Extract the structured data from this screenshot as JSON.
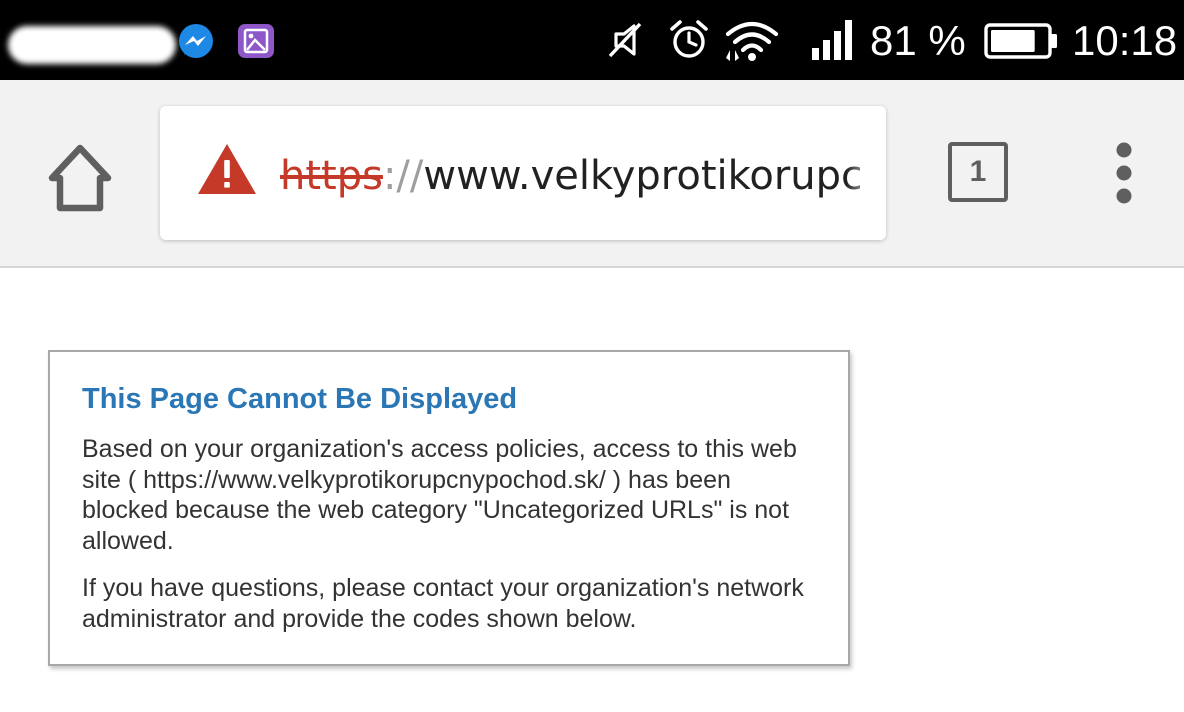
{
  "status_bar": {
    "battery_percent_text": "81 %",
    "battery_level": 0.81,
    "time": "10:18",
    "icons": [
      "messenger-icon",
      "gallery-icon",
      "mute-icon",
      "alarm-icon",
      "wifi-icon",
      "signal-icon",
      "battery-icon"
    ]
  },
  "toolbar": {
    "url_scheme": "https",
    "url_separator": "://",
    "url_host": "www.velkyprotikorupc",
    "tab_count": "1",
    "icons": [
      "home-icon",
      "warning-icon",
      "tab-switcher-icon",
      "more-vert-icon"
    ]
  },
  "page": {
    "title": "This Page Cannot Be Displayed",
    "paragraph_1": "Based on your organization's access policies, access to this web site ( https://www.velkyprotikorupcnypochod.sk/ ) has been blocked because the web category \"Uncategorized URLs\" is not allowed.",
    "paragraph_2": "If you have questions, please contact your organization's network administrator and provide the codes shown below."
  },
  "colors": {
    "status_bar_bg": "#000000",
    "toolbar_bg": "#f2f2f2",
    "warning_red": "#c53929",
    "title_blue": "#2b77b5",
    "body_text": "#333333",
    "messenger_blue": "#1e88e5",
    "gallery_purple": "#8e57c8"
  }
}
